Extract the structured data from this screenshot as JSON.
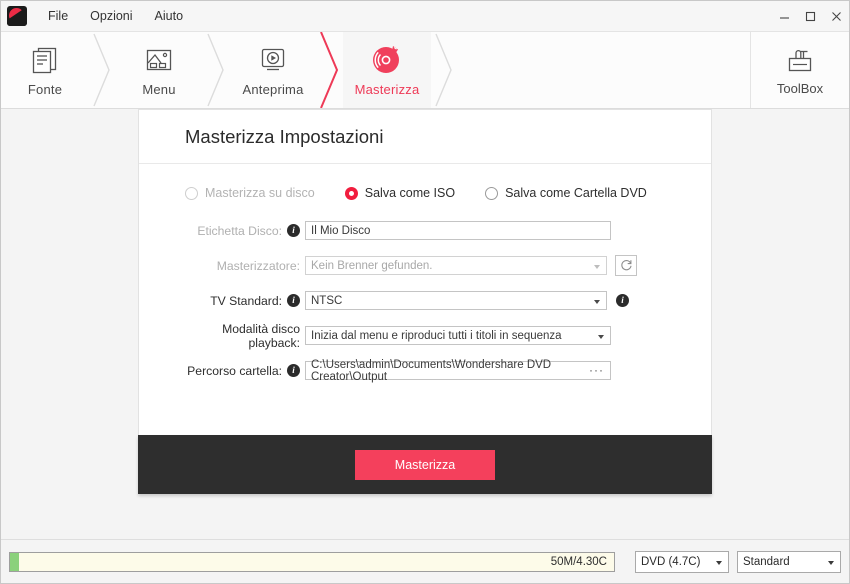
{
  "window": {
    "menus": [
      "File",
      "Opzioni",
      "Aiuto"
    ],
    "logo_icon": "app-logo-icon",
    "controls": {
      "minimize": "minimize-icon",
      "maximize": "maximize-icon",
      "close": "close-icon"
    }
  },
  "steps": [
    {
      "label": "Fonte",
      "icon": "documents-icon",
      "active": false
    },
    {
      "label": "Menu",
      "icon": "picture-menu-icon",
      "active": false
    },
    {
      "label": "Anteprima",
      "icon": "preview-play-icon",
      "active": false
    },
    {
      "label": "Masterizza",
      "icon": "burn-disc-icon",
      "active": true
    }
  ],
  "toolbox": {
    "label": "ToolBox",
    "icon": "toolbox-icon"
  },
  "card": {
    "title": "Masterizza Impostazioni",
    "radios": [
      {
        "label": "Masterizza su disco",
        "checked": false,
        "disabled": true
      },
      {
        "label": "Salva come ISO",
        "checked": true,
        "disabled": false
      },
      {
        "label": "Salva come Cartella DVD",
        "checked": false,
        "disabled": false
      }
    ],
    "fields": {
      "disc_label": {
        "label": "Etichetta Disco:",
        "value": "Il Mio Disco",
        "has_info": true
      },
      "burner": {
        "label": "Masterizzatore:",
        "value": "Kein Brenner gefunden.",
        "has_info": false,
        "disabled": true,
        "refresh_icon": "refresh-icon"
      },
      "tv_standard": {
        "label": "TV Standard:",
        "value": "NTSC",
        "has_info": true,
        "trailing_info": true
      },
      "playback_mode": {
        "label": "Modalità disco playback:",
        "value": "Inizia dal menu e riproduci tutti i titoli in sequenza",
        "has_info": false
      },
      "folder_path": {
        "label": "Percorso cartella:",
        "value": "C:\\Users\\admin\\Documents\\Wondershare DVD Creator\\Output",
        "has_info": true,
        "browse": "···"
      }
    },
    "burn_button": "Masterizza"
  },
  "statusbar": {
    "progress_text": "50M/4.30C",
    "progress_percent": 1,
    "disc_type": "DVD (4.7C)",
    "quality": "Standard"
  },
  "colors": {
    "accent": "#ee3a57",
    "radio_selected": "#f11d3e",
    "burn_button": "#f4405c",
    "footer_dark": "#2e2e2e",
    "progress_fill": "#8bd17c",
    "progress_track": "#fdfbe9"
  }
}
